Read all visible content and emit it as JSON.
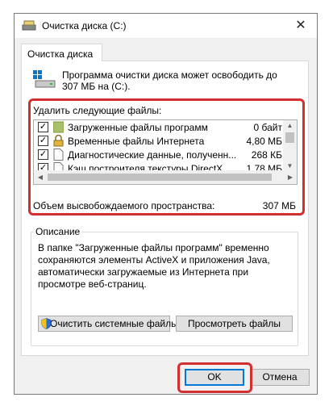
{
  "window": {
    "title": "Очистка диска  (C:)",
    "close_glyph": "✕"
  },
  "tab": {
    "label": "Очистка диска"
  },
  "intro": "Программа очистки диска может освободить до 307 МБ на (C:).",
  "files_label": "Удалить следующие файлы:",
  "files": [
    {
      "name": "Загруженные файлы программ",
      "size": "0 байт",
      "checked": true,
      "icon": "folder-icon"
    },
    {
      "name": "Временные файлы Интернета",
      "size": "4,80 МБ",
      "checked": true,
      "icon": "lock-icon"
    },
    {
      "name": "Диагностические данные, полученн...",
      "size": "268 КБ",
      "checked": true,
      "icon": "file-icon"
    },
    {
      "name": "Кэш построителя текстуры DirectX",
      "size": "1,78 МБ",
      "checked": true,
      "icon": "file-icon"
    }
  ],
  "checkmark": "✓",
  "total": {
    "label": "Объем высвобождаемого пространства:",
    "value": "307 МБ"
  },
  "description": {
    "legend": "Описание",
    "text": "В папке \"Загруженные файлы программ\" временно сохраняются элементы ActiveX и приложения Java, автоматически загружаемые из Интернета при просмотре веб-страниц."
  },
  "buttons": {
    "system": "Очистить системные файлы",
    "view": "Просмотреть файлы",
    "ok": "OK",
    "cancel": "Отмена"
  },
  "colors": {
    "highlight": "#d32f2f",
    "accent": "#0078d7"
  }
}
